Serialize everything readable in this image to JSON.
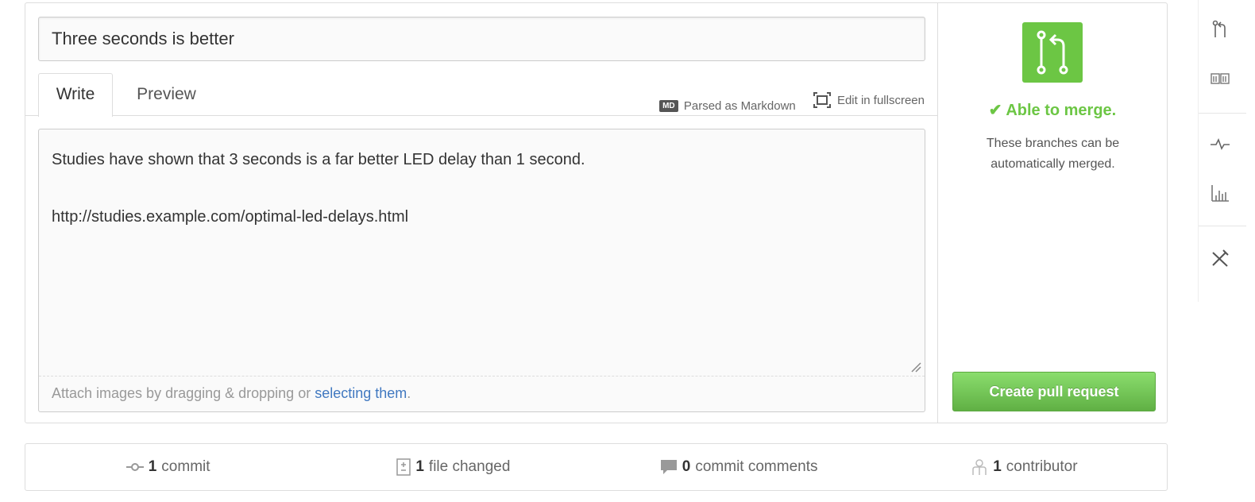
{
  "title_field": {
    "value": "Three seconds is better"
  },
  "tabs": [
    {
      "label": "Write",
      "selected": true
    },
    {
      "label": "Preview",
      "selected": false
    }
  ],
  "toolbar": {
    "markdown_badge": "MD",
    "markdown_label": "Parsed as Markdown",
    "fullscreen_label": "Edit in fullscreen"
  },
  "body": {
    "line1": "Studies have shown that 3 seconds is a far better LED delay than 1 second.",
    "line2": "http://studies.example.com/optimal-led-delays.html"
  },
  "attach": {
    "prefix": "Attach images by dragging & dropping or ",
    "link": "selecting them",
    "suffix": "."
  },
  "merge": {
    "icon": "git-pull-request-icon",
    "status": "✔ Able to merge.",
    "description": "These branches can be automatically merged.",
    "button": "Create pull request",
    "color": "#6cc644"
  },
  "summary": [
    {
      "icon": "commit-icon",
      "count": "1",
      "label": "commit"
    },
    {
      "icon": "file-diff-icon",
      "count": "1",
      "label": "file changed"
    },
    {
      "icon": "comment-icon",
      "count": "0",
      "label": "commit comments"
    },
    {
      "icon": "organization-icon",
      "count": "1",
      "label": "contributor"
    }
  ],
  "rail_icons": [
    "pull-request-icon",
    "wiki-book-icon",
    "pulse-icon",
    "graph-icon",
    "settings-tools-icon"
  ],
  "colors": {
    "accent_green": "#6cc644",
    "link_blue": "#4078c0",
    "border": "#dddddd"
  }
}
